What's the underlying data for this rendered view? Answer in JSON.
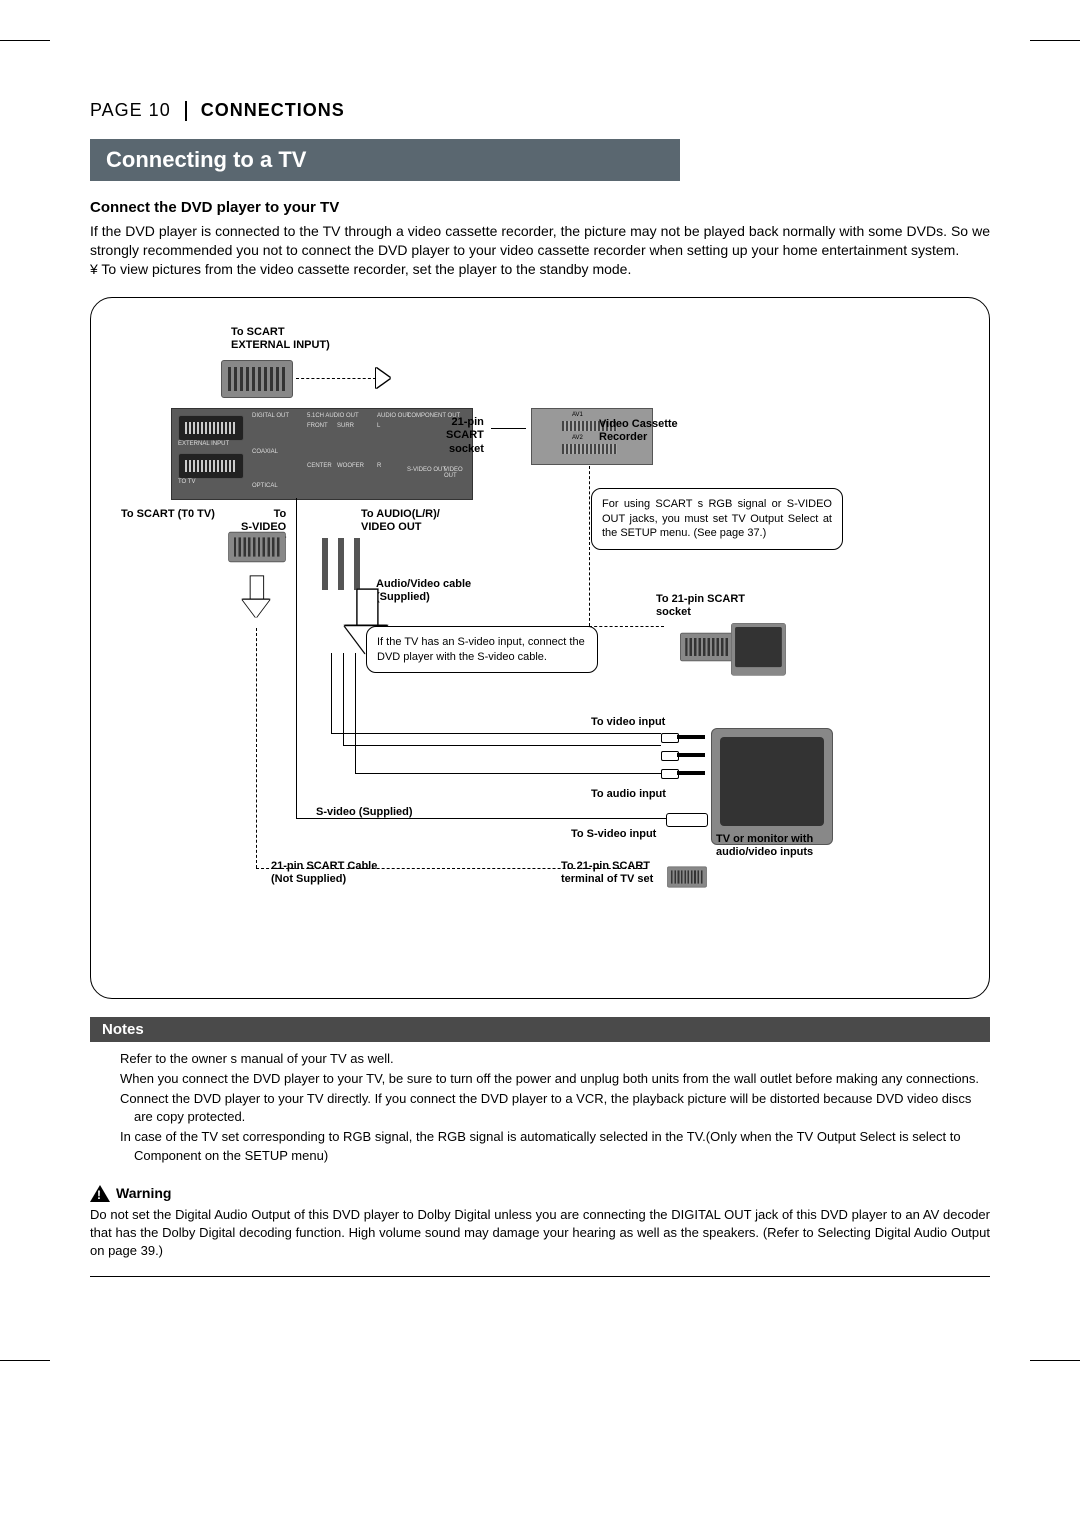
{
  "header": {
    "page": "PAGE 10",
    "section": "CONNECTIONS"
  },
  "ribbon": "Connecting to a TV",
  "intro": {
    "heading": "Connect the DVD player to your TV",
    "para": "If the DVD player is connected to the TV through a video cassette recorder, the picture may not be played back normally with some DVDs. So we strongly recommended you not to connect the DVD player to your video cassette recorder when setting up your home entertainment system.",
    "bullet": "¥  To view pictures from the video cassette recorder, set the player to the standby mode."
  },
  "diagram": {
    "to_scart_ext": "To SCART\nEXTERNAL INPUT)",
    "scart21": "21-pin\nSCART\nsocket",
    "vcr": "Video Cassette\nRecorder",
    "panel": {
      "digital_out": "DIGITAL OUT",
      "coaxial": "COAXIAL",
      "optical": "OPTICAL",
      "external_input": "EXTERNAL INPUT",
      "to_tv": "TO TV",
      "audio_out_51": "5.1CH AUDIO OUT",
      "front": "FRONT",
      "surr": "SURR",
      "center": "CENTER",
      "woofer": "WOOFER",
      "audio_out": "AUDIO OUT",
      "l": "L",
      "r": "R",
      "compo_out": "COMPONENT OUT",
      "svideo_out": "S-VIDEO OUT",
      "video_out": "VIDEO OUT"
    },
    "to_scart_tv": "To SCART (T0 TV)",
    "to_svideo_out": "To\nS-VIDEO\nOUT",
    "to_audio_video_out": "To AUDIO(L/R)/\nVIDEO OUT",
    "av_cable": "Audio/Video cable\n(Supplied)",
    "hint_rgb": "For using SCART s RGB signal or S-VIDEO OUT jacks, you must set  TV Output Select  at the SETUP menu. (See page 37.)",
    "hint_svideo": "If the TV has an S-video input, connect the DVD player with the S-video cable.",
    "to_21pin_scart_socket": "To 21-pin SCART\nsocket",
    "to_video_input": "To video input",
    "to_audio_input": "To audio input",
    "svideo_supplied": "S-video (Supplied)",
    "to_svideo_input": "To S-video input",
    "tv_monitor": "TV or monitor with\naudio/video inputs",
    "scart_cable_ns": "21-pin SCART Cable\n(Not Supplied)",
    "to_21pin_terminal": "To 21-pin SCART\nterminal of TV set",
    "av1": "AV1",
    "av2": "AV2"
  },
  "notes": {
    "title": "Notes",
    "items": [
      "Refer to the owner s manual of your TV as well.",
      "When you connect the DVD player to your TV, be sure to turn off the power and unplug both units from the wall outlet before making any connections.",
      "Connect the DVD player to your TV directly. If you connect the DVD player to a VCR, the playback picture will be distorted because DVD video discs are copy protected.",
      "In case of the TV set corresponding to RGB signal, the RGB signal is automatically selected in the TV.(Only when the  TV Output Select  is select to  Component  on the SETUP menu)"
    ]
  },
  "warning": {
    "title": "Warning",
    "text": "Do not set the Digital Audio Output of this DVD player to  Dolby Digital  unless you are connecting the DIGITAL OUT jack of this DVD player to an AV decoder that has the Dolby Digital decoding function. High volume sound may damage your hearing as well as the speakers. (Refer to  Selecting Digital Audio Output  on page 39.)"
  }
}
